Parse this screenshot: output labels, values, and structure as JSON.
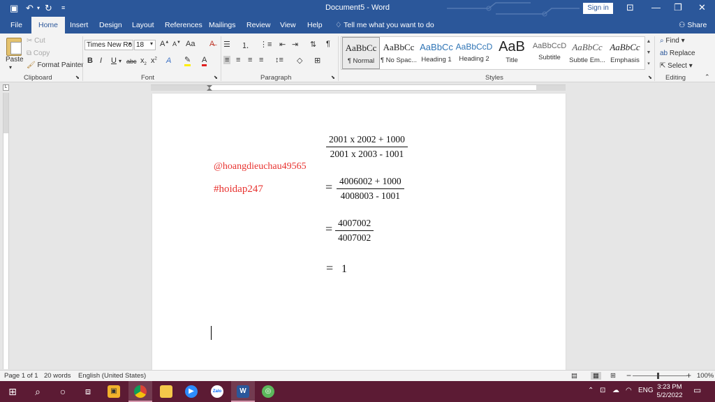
{
  "titlebar": {
    "title": "Document5 - Word",
    "signin": "Sign in",
    "save_icon": "save-icon",
    "undo_icon": "undo-icon",
    "redo_icon": "redo-icon"
  },
  "tabs": {
    "file": "File",
    "home": "Home",
    "insert": "Insert",
    "design": "Design",
    "layout": "Layout",
    "references": "References",
    "mailings": "Mailings",
    "review": "Review",
    "view": "View",
    "help": "Help",
    "tell_me": "Tell me what you want to do",
    "share": "Share"
  },
  "clipboard": {
    "paste": "Paste",
    "cut": "Cut",
    "copy": "Copy",
    "format_painter": "Format Painter",
    "label": "Clipboard"
  },
  "font": {
    "name": "Times New Ro",
    "size": "18",
    "case_label": "Aa",
    "strike": "abc",
    "bold": "B",
    "italic": "I",
    "underline": "U",
    "label": "Font"
  },
  "paragraph": {
    "label": "Paragraph"
  },
  "styles": {
    "label": "Styles",
    "items": [
      {
        "sample": "AaBbCc",
        "name": "¶ Normal"
      },
      {
        "sample": "AaBbCc",
        "name": "¶ No Spac..."
      },
      {
        "sample": "AaBbCc",
        "name": "Heading 1"
      },
      {
        "sample": "AaBbCcD",
        "name": "Heading 2"
      },
      {
        "sample": "AaB",
        "name": "Title"
      },
      {
        "sample": "AaBbCcD",
        "name": "Subtitle"
      },
      {
        "sample": "AaBbCc",
        "name": "Subtle Em..."
      },
      {
        "sample": "AaBbCc",
        "name": "Emphasis"
      }
    ]
  },
  "editing": {
    "find": "Find",
    "replace": "Replace",
    "select": "Select",
    "label": "Editing"
  },
  "document": {
    "handle1": "@hoangdieuchau49565",
    "handle2": "#hoidap247",
    "step1_num": "2001 x 2002  +  1000",
    "step1_den": "2001 x 2003 - 1001",
    "eq": "=",
    "step2_num": "4006002 + 1000",
    "step2_den": "4008003 - 1001",
    "step3_num": "4007002",
    "step3_den": "4007002",
    "result": "1"
  },
  "status": {
    "page": "Page 1 of 1",
    "words": "20 words",
    "language": "English (United States)",
    "zoom": "100%",
    "zoom_minus": "−",
    "zoom_plus": "+"
  },
  "taskbar": {
    "lang": "ENG",
    "time": "3:23 PM",
    "date": "5/2/2022",
    "zalo": "Zalo",
    "word": "W"
  }
}
